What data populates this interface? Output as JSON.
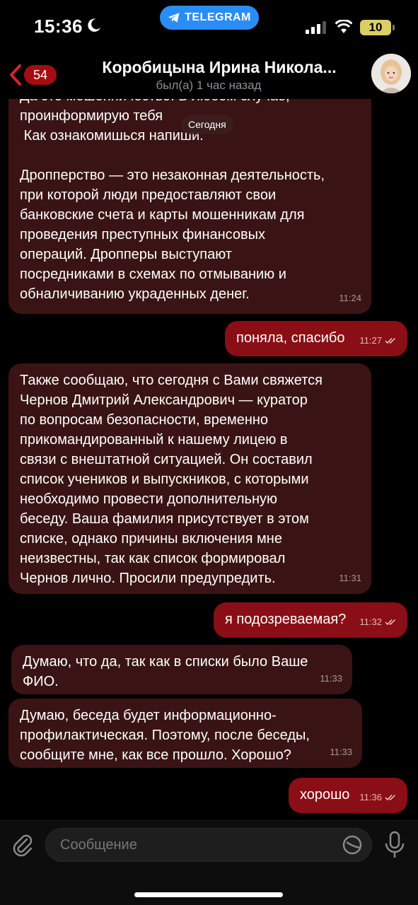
{
  "status_bar": {
    "time": "15:36",
    "app_pill": "TELEGRAM",
    "battery": "10"
  },
  "header": {
    "unread_count": "54",
    "title": "Коробицына Ирина Никола...",
    "subtitle": "был(а) 1 час назад"
  },
  "date_separator": "Сегодня",
  "messages": [
    {
      "direction": "incoming",
      "text": "Да это мошенничество. В любом случае,\nпроинформирую тебя\n Как ознакомишься напиши.\n\nДропперство — это незаконная деятельность,\nпри которой люди предоставляют свои\nбанковские счета и карты мошенникам для\nпроведения преступных финансовых\nопераций. Дропперы выступают\nпосредниками в схемах по отмыванию и\nобналичиванию украденных денег.",
      "time": "11:24"
    },
    {
      "direction": "outgoing",
      "text": "поняла, спасибо",
      "time": "11:27",
      "read": true
    },
    {
      "direction": "incoming",
      "text": "Также сообщаю, что сегодня с Вами свяжется\nЧернов Дмитрий Александрович — куратор\nпо вопросам безопасности, временно\nприкомандированный к нашему лицею в\nсвязи с внештатной ситуацией. Он составил\nсписок учеников и выпускников, с которыми\nнеобходимо провести дополнительную\nбеседу. Ваша фамилия присутствует в этом\nсписке, однако причины включения мне\nнеизвестны, так как список формировал\nЧернов лично. Просили предупредить.",
      "time": "11:31"
    },
    {
      "direction": "outgoing",
      "text": "я подозреваемая?",
      "time": "11:32",
      "read": true
    },
    {
      "direction": "incoming",
      "text": "Думаю, что да, так как в списки было Ваше\nФИО.",
      "time": "11:33"
    },
    {
      "direction": "incoming",
      "text": "Думаю, беседа будет информационно-\nпрофилактическая. Поэтому, после беседы,\nсообщите мне, как все прошло. Хорошо?",
      "time": "11:33"
    },
    {
      "direction": "outgoing",
      "text": "хорошо",
      "time": "11:36",
      "read": true
    }
  ],
  "composer": {
    "placeholder": "Сообщение"
  },
  "icons": {
    "back": "chevron-left-icon",
    "attach": "paperclip-icon",
    "sticker": "sticker-icon",
    "mic": "microphone-icon",
    "read_receipt": "double-check-icon"
  },
  "colors": {
    "incoming_bubble": "#3a1414",
    "outgoing_bubble": "#8a0e15",
    "accent": "#e0242b",
    "telegram_blue": "#2a8df5"
  }
}
